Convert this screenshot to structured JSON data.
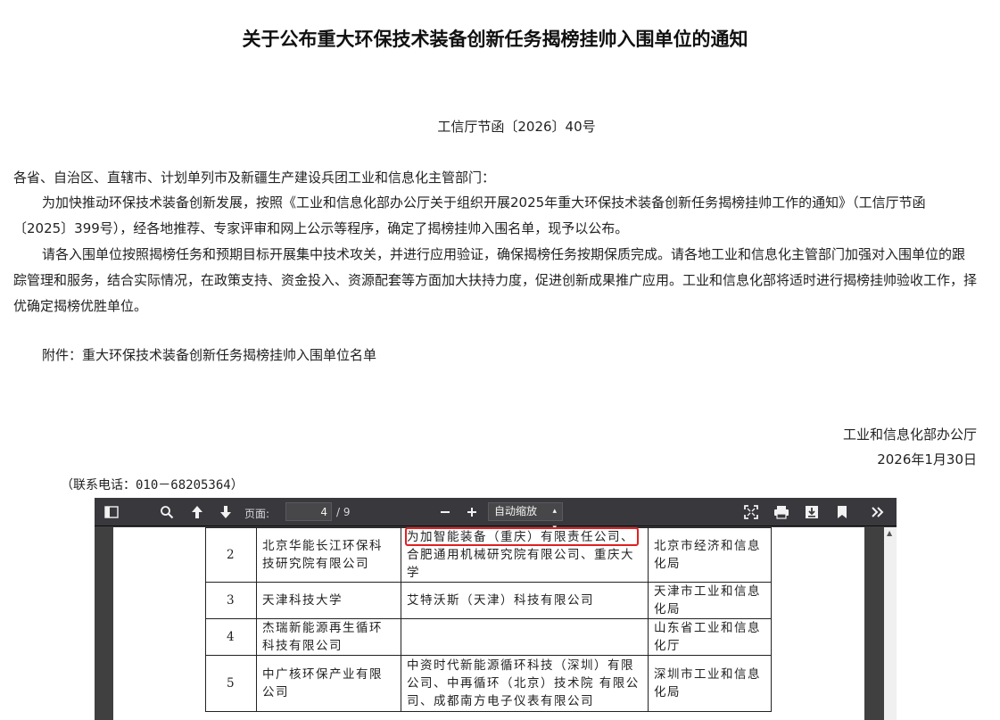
{
  "doc": {
    "title": "关于公布重大环保技术装备创新任务揭榜挂帅入围单位的通知",
    "doc_number": "工信厅节函〔2026〕40号",
    "addressee": "各省、自治区、直辖市、计划单列市及新疆生产建设兵团工业和信息化主管部门：",
    "para1": "为加快推动环保技术装备创新发展，按照《工业和信息化部办公厅关于组织开展2025年重大环保技术装备创新任务揭榜挂帅工作的通知》（工信厅节函〔2025〕399号），经各地推荐、专家评审和网上公示等程序，确定了揭榜挂帅入围名单，现予以公布。",
    "para2": "请各入围单位按照揭榜任务和预期目标开展集中技术攻关，并进行应用验证，确保揭榜任务按期保质完成。请各地工业和信息化主管部门加强对入围单位的跟踪管理和服务，结合实际情况，在政策支持、资金投入、资源配套等方面加大扶持力度，促进创新成果推广应用。工业和信息化部将适时进行揭榜挂帅验收工作，择优确定揭榜优胜单位。",
    "attachment": "附件：重大环保技术装备创新任务揭榜挂帅入围单位名单",
    "signer": "工业和信息化部办公厅",
    "date": "2026年1月30日",
    "phone": "（联系电话：010－68205364）"
  },
  "viewer": {
    "page_label": "页面:",
    "page_current": "4",
    "page_total": "/ 9",
    "zoom_label": "自动缩放",
    "colors": {
      "toolbar": "#38383d",
      "canvas": "#404040",
      "highlight": "#e02020"
    }
  },
  "table": {
    "rows": [
      {
        "no": "2",
        "lead": "北京华能长江环保科技研究院有限公司",
        "partners": "为加智能装备（重庆）有限责任公司、合肥通用机械研究院有限公司、重庆大学",
        "recommender": "北京市经济和信息化局"
      },
      {
        "no": "3",
        "lead": "天津科技大学",
        "partners": "艾特沃斯（天津）科技有限公司",
        "recommender": "天津市工业和信息化局"
      },
      {
        "no": "4",
        "lead": "杰瑞新能源再生循环科技有限公司",
        "partners": "",
        "recommender": "山东省工业和信息化厅"
      },
      {
        "no": "5",
        "lead": "中广核环保产业有限公司",
        "partners": "中资时代新能源循环科技（深圳）有限公司、中再循环（北京）技术院 有限公司、成都南方电子仪表有限公司",
        "recommender": "深圳市工业和信息化局"
      }
    ]
  }
}
